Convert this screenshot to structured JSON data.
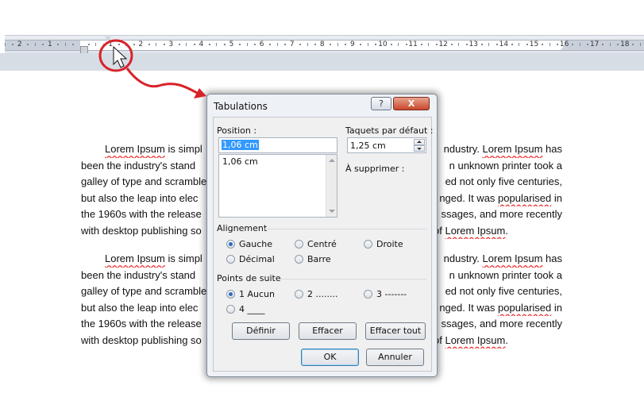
{
  "ruler": {
    "left_numbers": [
      "2",
      "1"
    ],
    "right_numbers": [
      "1",
      "2",
      "3",
      "4",
      "5",
      "6",
      "7",
      "8",
      "9",
      "10",
      "11",
      "12",
      "13",
      "14",
      "15",
      "16",
      "17",
      "18"
    ]
  },
  "document": {
    "paragraph1": [
      [
        "Lorem Ipsum",
        " is simpl"
      ],
      [
        "been the industry's stand"
      ],
      [
        "galley of type and scramble"
      ],
      [
        "but also the leap into elec"
      ],
      [
        "the 1960s with the release"
      ],
      [
        "with desktop publishing so"
      ]
    ],
    "p_right": [
      "ndustry. ",
      "Lorem Ipsum",
      " has",
      "n unknown printer took a",
      "ed not only five centuries,",
      "nged. It was ",
      "popularised",
      " in",
      "ssages, and more recently",
      "of ",
      "Lorem Ipsum",
      "."
    ]
  },
  "dialog": {
    "title": "Tabulations",
    "help_label": "?",
    "close_label": "X",
    "position_label": "Position :",
    "position_value": "1,06 cm",
    "position_list": [
      "1,06 cm"
    ],
    "default_tabs_label": "Taquets par défaut :",
    "default_tabs_value": "1,25 cm",
    "to_clear_label": "À supprimer :",
    "alignment_label": "Alignement",
    "alignment_options": {
      "gauche": "Gauche",
      "centre": "Centré",
      "droite": "Droite",
      "decimal": "Décimal",
      "barre": "Barre"
    },
    "leader_label": "Points de suite",
    "leader_options": {
      "none": "1 Aucun",
      "dots": "2 ........",
      "dashes": "3 -------",
      "underline": "4 ____"
    },
    "buttons": {
      "set": "Définir",
      "clear": "Effacer",
      "clear_all": "Effacer tout",
      "ok": "OK",
      "cancel": "Annuler"
    }
  },
  "colors": {
    "annotation_red": "#d8222a",
    "selection_blue": "#3399ff"
  }
}
